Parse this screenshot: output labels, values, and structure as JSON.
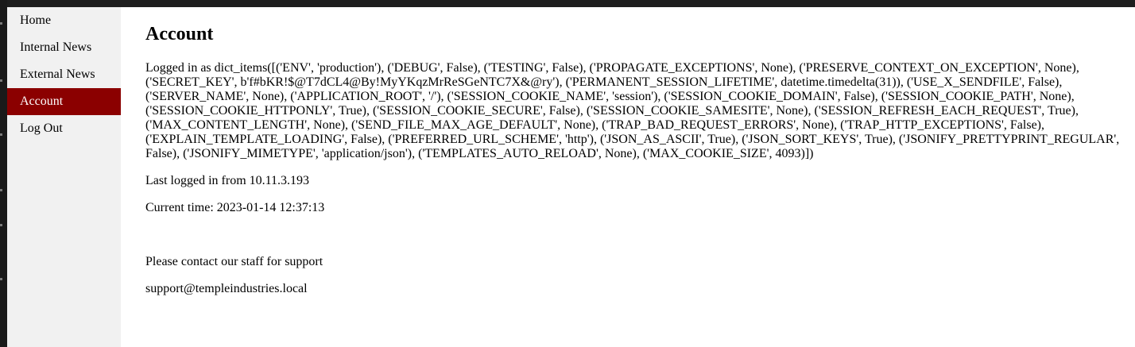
{
  "sidebar": {
    "items": [
      {
        "label": "Home",
        "active": false
      },
      {
        "label": "Internal News",
        "active": false
      },
      {
        "label": "External News",
        "active": false
      },
      {
        "label": "Account",
        "active": true
      },
      {
        "label": "Log Out",
        "active": false
      }
    ]
  },
  "main": {
    "title": "Account",
    "logged_in_text": "Logged in as dict_items([('ENV', 'production'), ('DEBUG', False), ('TESTING', False), ('PROPAGATE_EXCEPTIONS', None), ('PRESERVE_CONTEXT_ON_EXCEPTION', None), ('SECRET_KEY', b'f#bKR!$@T7dCL4@By!MyYKqzMrReSGeNTC7X&@ry'), ('PERMANENT_SESSION_LIFETIME', datetime.timedelta(31)), ('USE_X_SENDFILE', False), ('SERVER_NAME', None), ('APPLICATION_ROOT', '/'), ('SESSION_COOKIE_NAME', 'session'), ('SESSION_COOKIE_DOMAIN', False), ('SESSION_COOKIE_PATH', None), ('SESSION_COOKIE_HTTPONLY', True), ('SESSION_COOKIE_SECURE', False), ('SESSION_COOKIE_SAMESITE', None), ('SESSION_REFRESH_EACH_REQUEST', True), ('MAX_CONTENT_LENGTH', None), ('SEND_FILE_MAX_AGE_DEFAULT', None), ('TRAP_BAD_REQUEST_ERRORS', None), ('TRAP_HTTP_EXCEPTIONS', False), ('EXPLAIN_TEMPLATE_LOADING', False), ('PREFERRED_URL_SCHEME', 'http'), ('JSON_AS_ASCII', True), ('JSON_SORT_KEYS', True), ('JSONIFY_PRETTYPRINT_REGULAR', False), ('JSONIFY_MIMETYPE', 'application/json'), ('TEMPLATES_AUTO_RELOAD', None), ('MAX_COOKIE_SIZE', 4093)])",
    "last_login": "Last logged in from 10.11.3.193",
    "current_time": "Current time: 2023-01-14 12:37:13",
    "support_text": "Please contact our staff for support",
    "support_email": "support@templeindustries.local"
  },
  "colors": {
    "active_bg": "#8b0000",
    "sidebar_bg": "#f1f1f1"
  }
}
